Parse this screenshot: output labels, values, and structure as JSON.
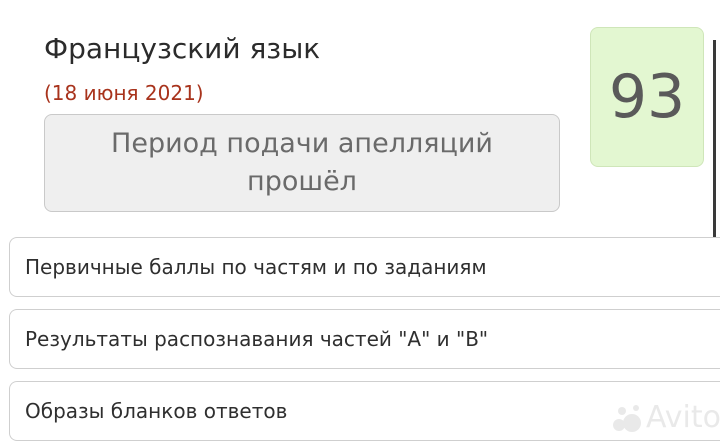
{
  "exam": {
    "subject": "Французский язык",
    "date": "(18 июня 2021)",
    "score": "93",
    "appeal_status": "Период подачи апелляций прошёл"
  },
  "sections": [
    {
      "label": "Первичные баллы по частям и по заданиям"
    },
    {
      "label": "Результаты распознавания частей \"A\" и \"B\""
    },
    {
      "label": "Образы бланков ответов"
    }
  ],
  "watermark": {
    "text": "Avito",
    "icon": "avito-logo-icon"
  },
  "colors": {
    "date_text": "#a8331c",
    "score_bg": "#e3f7d1",
    "appeal_bg": "#efefef"
  }
}
